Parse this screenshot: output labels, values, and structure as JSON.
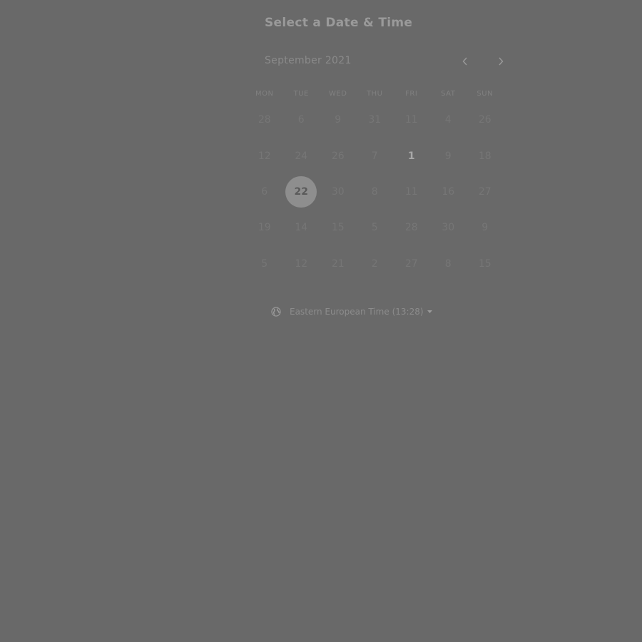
{
  "title": "Select a Date & Time",
  "calendar": {
    "month_label": "September 2021",
    "prev_icon": "chevron-left-icon",
    "next_icon": "chevron-right-icon",
    "weekdays": [
      "MON",
      "TUE",
      "WED",
      "THU",
      "FRI",
      "SAT",
      "SUN"
    ],
    "weeks": [
      [
        "28",
        "6",
        "9",
        "31",
        "11",
        "4",
        "26"
      ],
      [
        "12",
        "24",
        "26",
        "7",
        "1",
        "9",
        "18"
      ],
      [
        "6",
        "22",
        "30",
        "8",
        "11",
        "16",
        "27"
      ],
      [
        "19",
        "14",
        "15",
        "5",
        "28",
        "30",
        "9"
      ],
      [
        "5",
        "12",
        "21",
        "2",
        "27",
        "8",
        "15"
      ]
    ],
    "bold_day": "1",
    "selected_day": "22"
  },
  "timezone": {
    "icon": "globe-icon",
    "label": "Eastern European Time (13:28)",
    "caret_icon": "caret-down-icon"
  },
  "colors": {
    "background": "#696969",
    "selected_circle": "#8e8e8e"
  }
}
